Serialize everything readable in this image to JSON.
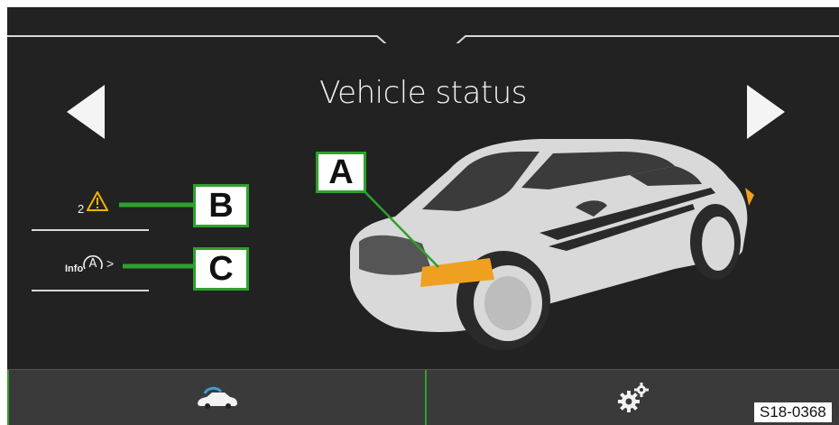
{
  "header": {
    "title": "Vehicle status"
  },
  "navigation": {
    "prev_icon": "triangle-left-icon",
    "next_icon": "triangle-right-icon"
  },
  "side_menu": {
    "items": [
      {
        "icon": "warning-icon",
        "prefix": "2",
        "callout": "B"
      },
      {
        "icon": "info-assist-icon",
        "prefix": "Info",
        "suffix": ">",
        "callout": "C"
      }
    ]
  },
  "car": {
    "callout": "A",
    "highlight_color": "#f0a020",
    "body_color": "#d9d9d9"
  },
  "bottom_tabs": [
    {
      "name": "vehicle-status",
      "icon": "car-status-icon"
    },
    {
      "name": "settings",
      "icon": "gears-icon"
    }
  ],
  "colors": {
    "screen_bg": "#222222",
    "accent": "#2da12d",
    "text": "#f2f2f2",
    "icon_blue": "#3aa0d8"
  },
  "figure_code": "S18-0368"
}
